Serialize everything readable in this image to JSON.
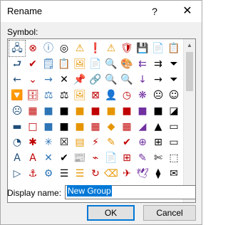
{
  "window": {
    "title": "Rename",
    "help": "?",
    "close": "✕"
  },
  "symbol_label": "Symbol:",
  "symbols": [
    "🖧",
    "⊗",
    "ⓘ",
    "◎",
    "⚠",
    "❗",
    "⚠",
    "🛡",
    "💾",
    "📄",
    "📋",
    "⮐",
    "✔",
    "🗒",
    "📋",
    "🖼",
    "📄",
    "🔍",
    "🎨",
    "⇇",
    "⇉",
    "⏷",
    "←",
    "⌄",
    "→",
    "✕",
    "📌",
    "🔗",
    "🔍",
    "🔍",
    "↓",
    "→",
    "⏷",
    "🔽",
    "🗄",
    "⚖",
    "⚖",
    "🖼",
    "⊠",
    "👤",
    "◷",
    "❋",
    "😐",
    "☺",
    "☹",
    "▦",
    "■",
    "■",
    "■",
    "■",
    "■",
    "■",
    "■",
    "■",
    "◪",
    "▬",
    "□",
    "■",
    "■",
    "■",
    "▦",
    "◆",
    "▦",
    "◢",
    "▲",
    "▭",
    "◔",
    "✱",
    "✳",
    "☒",
    "▤",
    "⚡",
    "✎",
    "✔",
    "⊕",
    "⊞",
    "▭",
    "A",
    "A",
    "✕",
    "✔",
    "📰",
    "⌁",
    "📄",
    "⊞",
    "✎",
    "✄",
    "⬚",
    "▷",
    "⚓",
    "⚙",
    "☰",
    "☰",
    "↻",
    "⌫",
    "✈",
    "🕊",
    "⧫",
    "✉",
    "▦",
    "▦",
    "▦",
    "▦",
    "▦",
    "▦",
    "▦",
    "▦",
    "▦",
    "▦",
    "▦"
  ],
  "scroll": {
    "up": "▲",
    "down": "▼"
  },
  "display_name": {
    "label": "Display name:",
    "value": "New Group"
  },
  "buttons": {
    "ok": "OK",
    "cancel": "Cancel"
  }
}
